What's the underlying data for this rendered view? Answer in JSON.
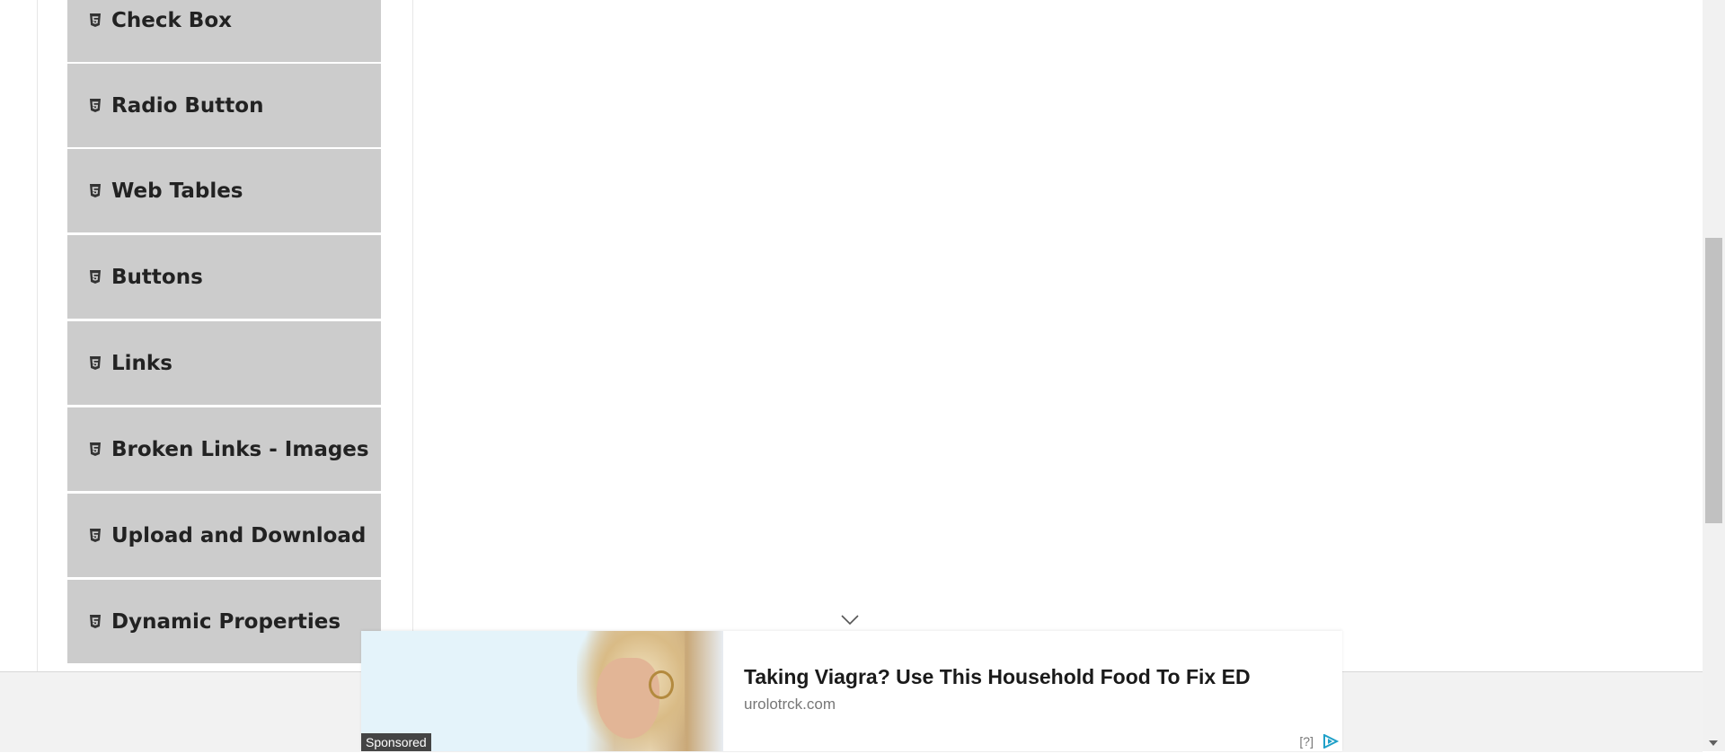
{
  "menu": {
    "items": [
      {
        "label": "Check Box",
        "icon": "html5-icon"
      },
      {
        "label": "Radio Button",
        "icon": "html5-icon"
      },
      {
        "label": "Web Tables",
        "icon": "html5-icon"
      },
      {
        "label": "Buttons",
        "icon": "html5-icon"
      },
      {
        "label": "Links",
        "icon": "html5-icon"
      },
      {
        "label": "Broken Links - Images",
        "icon": "html5-icon"
      },
      {
        "label": "Upload and Download",
        "icon": "html5-icon"
      },
      {
        "label": "Dynamic Properties",
        "icon": "html5-icon"
      }
    ]
  },
  "ad": {
    "sponsored_label": "Sponsored",
    "title": "Taking Viagra? Use This Household Food To Fix ED",
    "domain": "urolotrck.com",
    "info_label": "[?]",
    "collapse_icon": "chevron-down-icon",
    "logo_icon": "adchoices-icon"
  },
  "colors": {
    "menu_bg": "#cccccc",
    "menu_text": "#222222",
    "footer_bg": "#f2f2f2"
  }
}
